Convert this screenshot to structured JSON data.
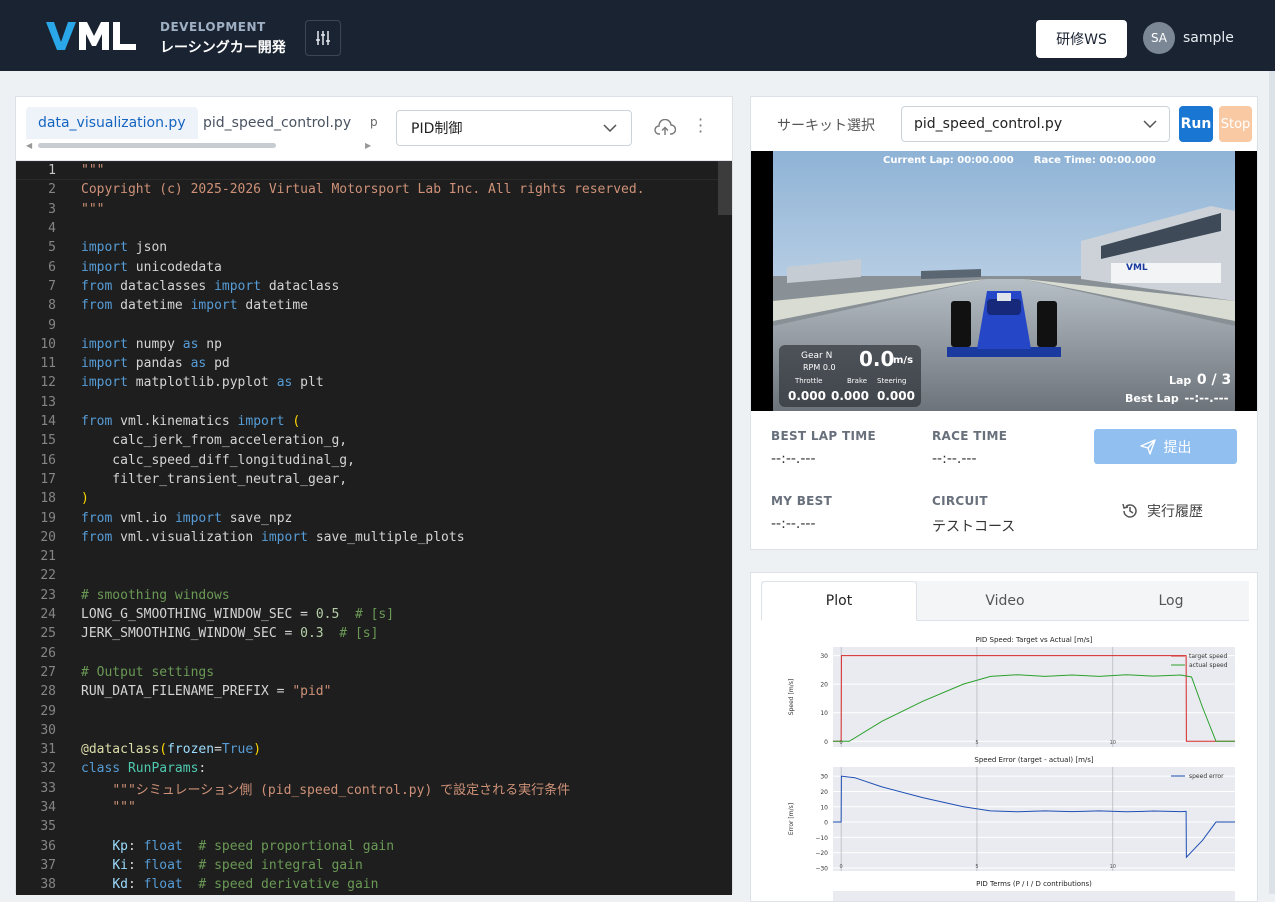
{
  "header": {
    "brand_sub": "DEVELOPMENT",
    "brand_title": "レーシングカー開発",
    "workspace_button": "研修WS",
    "avatar_initials": "SA",
    "username": "sample"
  },
  "editor": {
    "tabs": [
      {
        "label": "data_visualization.py",
        "active": true
      },
      {
        "label": "pid_speed_control.py",
        "active": false
      }
    ],
    "tab_overflow": "p",
    "dropdown_value": "PID制御",
    "current_line": 1,
    "lines": [
      {
        "n": "1",
        "html": "<span class='s'>\"\"\"</span>"
      },
      {
        "n": "2",
        "html": "<span class='s'>Copyright (c) 2025-2026 Virtual Motorsport Lab Inc. All rights reserved.</span>"
      },
      {
        "n": "3",
        "html": "<span class='s'>\"\"\"</span>"
      },
      {
        "n": "4",
        "html": ""
      },
      {
        "n": "5",
        "html": "<span class='k'>import</span> json"
      },
      {
        "n": "6",
        "html": "<span class='k'>import</span> unicodedata"
      },
      {
        "n": "7",
        "html": "<span class='k'>from</span> dataclasses <span class='k'>import</span> dataclass"
      },
      {
        "n": "8",
        "html": "<span class='k'>from</span> datetime <span class='k'>import</span> datetime"
      },
      {
        "n": "9",
        "html": ""
      },
      {
        "n": "10",
        "html": "<span class='k'>import</span> numpy <span class='k'>as</span> np"
      },
      {
        "n": "11",
        "html": "<span class='k'>import</span> pandas <span class='k'>as</span> pd"
      },
      {
        "n": "12",
        "html": "<span class='k'>import</span> matplotlib.pyplot <span class='k'>as</span> plt"
      },
      {
        "n": "13",
        "html": ""
      },
      {
        "n": "14",
        "html": "<span class='k'>from</span> vml.kinematics <span class='k'>import</span> <span class='br'>(</span>"
      },
      {
        "n": "15",
        "html": "    calc_jerk_from_acceleration_g,"
      },
      {
        "n": "16",
        "html": "    calc_speed_diff_longitudinal_g,"
      },
      {
        "n": "17",
        "html": "    filter_transient_neutral_gear,"
      },
      {
        "n": "18",
        "html": "<span class='br'>)</span>"
      },
      {
        "n": "19",
        "html": "<span class='k'>from</span> vml.io <span class='k'>import</span> save_npz"
      },
      {
        "n": "20",
        "html": "<span class='k'>from</span> vml.visualization <span class='k'>import</span> save_multiple_plots"
      },
      {
        "n": "21",
        "html": ""
      },
      {
        "n": "22",
        "html": ""
      },
      {
        "n": "23",
        "html": "<span class='c'># smoothing windows</span>"
      },
      {
        "n": "24",
        "html": "LONG_G_SMOOTHING_WINDOW_SEC = <span class='n'>0.5</span>  <span class='c'># [s]</span>"
      },
      {
        "n": "25",
        "html": "JERK_SMOOTHING_WINDOW_SEC = <span class='n'>0.3</span>  <span class='c'># [s]</span>"
      },
      {
        "n": "26",
        "html": ""
      },
      {
        "n": "27",
        "html": "<span class='c'># Output settings</span>"
      },
      {
        "n": "28",
        "html": "RUN_DATA_FILENAME_PREFIX = <span class='s'>\"pid\"</span>"
      },
      {
        "n": "29",
        "html": ""
      },
      {
        "n": "30",
        "html": ""
      },
      {
        "n": "31",
        "html": "<span class='y'>@dataclass</span><span class='br'>(</span><span class='p'>frozen</span>=<span class='k'>True</span><span class='br'>)</span>"
      },
      {
        "n": "32",
        "html": "<span class='k'>class</span> <span class='t'>RunParams</span>:"
      },
      {
        "n": "33",
        "html": "    <span class='s'>\"\"\"シミュレーション側 (pid_speed_control.py) で設定される実行条件</span>"
      },
      {
        "n": "34",
        "html": "    <span class='s'>\"\"\"</span>"
      },
      {
        "n": "35",
        "html": ""
      },
      {
        "n": "36",
        "html": "    <span class='p'>Kp</span>: <span class='k'>float</span>  <span class='c'># speed proportional gain</span>"
      },
      {
        "n": "37",
        "html": "    <span class='p'>Ki</span>: <span class='k'>float</span>  <span class='c'># speed integral gain</span>"
      },
      {
        "n": "38",
        "html": "    <span class='p'>Kd</span>: <span class='k'>float</span>  <span class='c'># speed derivative gain</span>"
      }
    ]
  },
  "sim": {
    "circuit_label": "サーキット選択",
    "circuit_value": "pid_speed_control.py",
    "run_label": "Run",
    "stop_label": "Stop",
    "hud": {
      "current_lap": "Current Lap: 00:00.000",
      "race_time": "Race Time: 00:00.000",
      "gear": "Gear  N",
      "rpm": "RPM 0.0",
      "speed": "0.0",
      "speed_unit": "m/s",
      "throttle_label": "Throttle",
      "brake_label": "Brake",
      "steering_label": "Steering",
      "throttle": "0.000",
      "brake": "0.000",
      "steering": "0.000",
      "lap_label": "Lap",
      "lap_value": "0 / 3",
      "best_lap_label": "Best Lap",
      "best_lap_value": "--:--.---",
      "banner": "VML"
    },
    "stats": {
      "best_lap_label": "BEST LAP TIME",
      "best_lap_value": "--:--.---",
      "race_time_label": "RACE TIME",
      "race_time_value": "--:--.---",
      "my_best_label": "MY BEST",
      "my_best_value": "--:--.---",
      "circuit_label": "CIRCUIT",
      "circuit_value": "テストコース"
    },
    "submit_label": "提出",
    "history_label": "実行履歴"
  },
  "plots": {
    "tabs": [
      "Plot",
      "Video",
      "Log"
    ],
    "active_tab": "Plot"
  },
  "chart_data": [
    {
      "type": "line",
      "title": "PID Speed: Target vs Actual [m/s]",
      "ylabel": "Speed [m/s]",
      "ylim": [
        -2,
        33
      ],
      "y_ticks": [
        "30",
        "20",
        "10",
        "0"
      ],
      "x_ticks": [
        "0",
        "5",
        "10"
      ],
      "xlim": [
        -0.3,
        14.5
      ],
      "legend_placement": "top-right",
      "series": [
        {
          "name": "target speed",
          "color": "#d62728",
          "x": [
            -0.3,
            0,
            0.01,
            12.7,
            12.71,
            14.5
          ],
          "values": [
            0,
            0,
            30,
            30,
            0,
            0
          ]
        },
        {
          "name": "actual speed",
          "color": "#2ca02c",
          "x": [
            -0.3,
            0.3,
            1.5,
            3,
            4.5,
            5.5,
            6.5,
            7.5,
            8.5,
            9.5,
            10.5,
            11.5,
            12.5,
            12.9,
            13.3,
            13.8,
            14.5
          ],
          "values": [
            0,
            0,
            7,
            14,
            20,
            22.7,
            23.3,
            22.7,
            23.2,
            22.7,
            23.3,
            22.8,
            23.2,
            22.5,
            12,
            0,
            0
          ]
        }
      ]
    },
    {
      "type": "line",
      "title": "Speed Error (target - actual) [m/s]",
      "ylabel": "Error [m/s]",
      "ylim": [
        -32,
        36
      ],
      "y_ticks": [
        "30",
        "20",
        "10",
        "0",
        "−10",
        "−20",
        "−30"
      ],
      "x_ticks": [
        "0",
        "5",
        "10"
      ],
      "xlim": [
        -0.3,
        14.5
      ],
      "legend_placement": "top-right",
      "series": [
        {
          "name": "speed error",
          "color": "#1f4fb4",
          "x": [
            -0.3,
            0,
            0.01,
            0.5,
            1.5,
            3,
            4.5,
            5.5,
            6.5,
            7.5,
            8.5,
            9.5,
            10.5,
            11.5,
            12.5,
            12.7,
            12.71,
            13.3,
            13.8,
            14.5
          ],
          "values": [
            0,
            0,
            30,
            29,
            23,
            16,
            10,
            7.3,
            6.7,
            7.3,
            6.8,
            7.3,
            6.7,
            7.2,
            6.8,
            7,
            -23,
            -12,
            0,
            0
          ]
        }
      ]
    },
    {
      "type": "line",
      "title": "PID Terms (P / I / D contributions)"
    }
  ]
}
